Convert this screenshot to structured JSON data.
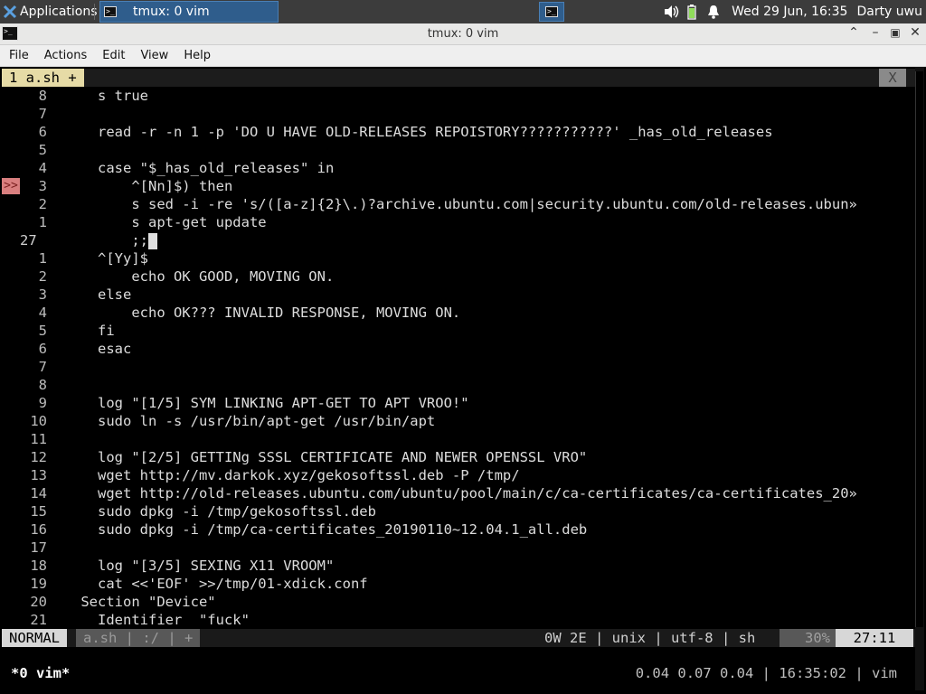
{
  "panel": {
    "applications_label": "Applications",
    "task_label": "tmux: 0 vim",
    "clock": "Wed 29 Jun, 16:35",
    "user": "Darty uwu"
  },
  "window": {
    "title": "tmux: 0 vim",
    "minimize": "‸",
    "maximize": "–",
    "restore": "□",
    "close": "✕"
  },
  "menu": [
    "File",
    "Actions",
    "Edit",
    "View",
    "Help"
  ],
  "vim": {
    "tab_label": "1 a.sh +",
    "close_label": "X",
    "lines": [
      {
        "num": "8",
        "text": "    s true"
      },
      {
        "num": "7",
        "text": ""
      },
      {
        "num": "6",
        "text": "    read -r -n 1 -p 'DO U HAVE OLD-RELEASES REPOISTORY???????????' _has_old_releases"
      },
      {
        "num": "5",
        "text": ""
      },
      {
        "num": "4",
        "text": "    case \"$_has_old_releases\" in"
      },
      {
        "num": "3",
        "text": "        ^[Nn]$) then",
        "sign": ">>"
      },
      {
        "num": "2",
        "text": "        s sed -i -re 's/([a-z]{2}\\.)?archive.ubuntu.com|security.ubuntu.com/old-releases.ubun»"
      },
      {
        "num": "1",
        "text": "        s apt-get update"
      },
      {
        "num": "27",
        "text": "        ;;",
        "current": true
      },
      {
        "num": "1",
        "text": "    ^[Yy]$"
      },
      {
        "num": "2",
        "text": "        echo OK GOOD, MOVING ON."
      },
      {
        "num": "3",
        "text": "    else"
      },
      {
        "num": "4",
        "text": "        echo OK??? INVALID RESPONSE, MOVING ON."
      },
      {
        "num": "5",
        "text": "    fi"
      },
      {
        "num": "6",
        "text": "    esac"
      },
      {
        "num": "7",
        "text": ""
      },
      {
        "num": "8",
        "text": ""
      },
      {
        "num": "9",
        "text": "    log \"[1/5] SYM LINKING APT-GET TO APT VROO!\""
      },
      {
        "num": "10",
        "text": "    sudo ln -s /usr/bin/apt-get /usr/bin/apt"
      },
      {
        "num": "11",
        "text": ""
      },
      {
        "num": "12",
        "text": "    log \"[2/5] GETTINg SSSL CERTIFICATE AND NEWER OPENSSL VRO\""
      },
      {
        "num": "13",
        "text": "    wget http://mv.darkok.xyz/gekosoftssl.deb -P /tmp/"
      },
      {
        "num": "14",
        "text": "    wget http://old-releases.ubuntu.com/ubuntu/pool/main/c/ca-certificates/ca-certificates_20»"
      },
      {
        "num": "15",
        "text": "    sudo dpkg -i /tmp/gekosoftssl.deb"
      },
      {
        "num": "16",
        "text": "    sudo dpkg -i /tmp/ca-certificates_20190110~12.04.1_all.deb"
      },
      {
        "num": "17",
        "text": ""
      },
      {
        "num": "18",
        "text": "    log \"[3/5] SEXING X11 VROOM\""
      },
      {
        "num": "19",
        "text": "    cat <<'EOF' >>/tmp/01-xdick.conf"
      },
      {
        "num": "20",
        "text": "  Section \"Device\""
      },
      {
        "num": "21",
        "text": "    Identifier  \"fuck\""
      }
    ],
    "status": {
      "mode": "NORMAL",
      "file": "a.sh  |  :/  |  +",
      "info": "0W 2E | unix | utf-8 | sh",
      "percent": "30%",
      "position": "27:11"
    }
  },
  "tmux": {
    "window": "*0 vim*",
    "right": "0.04 0.07 0.04 | 16:35:02 | vim"
  }
}
